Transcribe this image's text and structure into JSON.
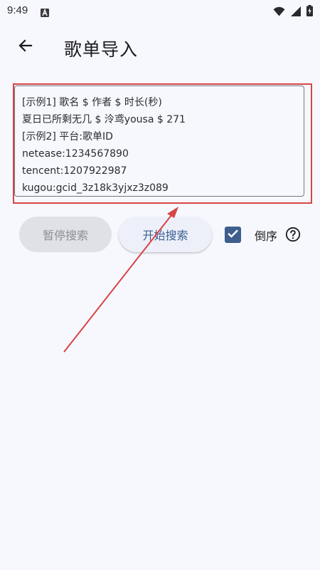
{
  "status_bar": {
    "time": "9:49",
    "app_icon": "text-a-icon",
    "icons": [
      "wifi-icon",
      "signal-icon",
      "battery-charging-icon"
    ]
  },
  "header": {
    "back_icon": "arrow-back-icon",
    "title": "歌单导入"
  },
  "input": {
    "lines": [
      "[示例1] 歌名 $ 作者 $ 时长(秒)",
      "夏日已所剩无几 $ 泠鸢yousa $ 271",
      "[示例2] 平台:歌单ID",
      "netease:1234567890",
      "tencent:1207922987",
      "kugou:gcid_3z18k3yjxz3z089"
    ]
  },
  "actions": {
    "pause_label": "暂停搜索",
    "start_label": "开始搜索",
    "reverse_label": "倒序",
    "reverse_checked": true,
    "help_icon": "help-circle-icon"
  },
  "colors": {
    "background": "#f7f8fe",
    "accent": "#3e5e8c",
    "start_text": "#3a5f92",
    "disabled_bg": "#e0e1e6",
    "annotation_red": "#d64545"
  }
}
